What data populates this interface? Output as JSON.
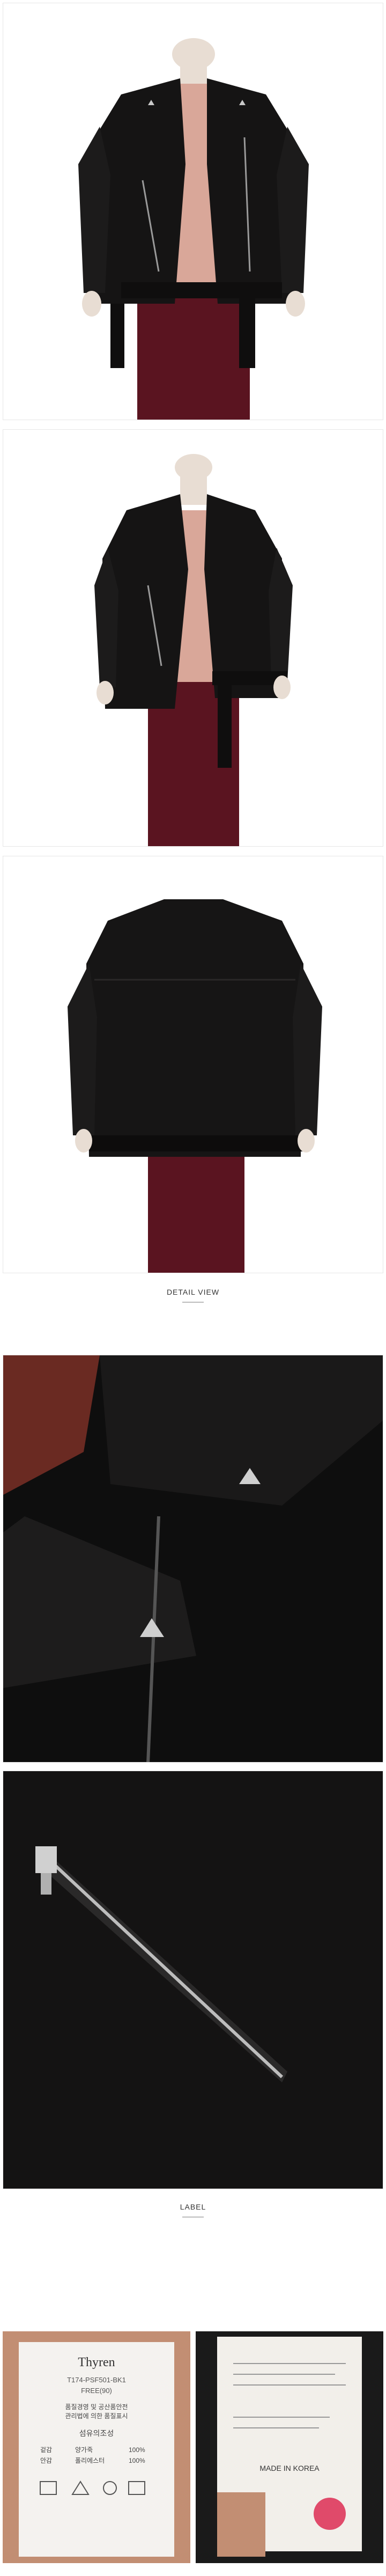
{
  "sections": {
    "detail_view": "DETAIL VIEW",
    "label": "LABEL"
  },
  "images": {
    "front_open": "jacket-front-open-photo",
    "front_styled": "jacket-front-styled-photo",
    "back": "jacket-back-photo",
    "collar_detail": "collar-stud-detail-photo",
    "zipper_detail": "zipper-pocket-detail-photo",
    "label_left": "care-label-photo",
    "label_right": "composition-label-photo"
  },
  "label_text": {
    "brand": "Thyren",
    "code1": "T174-PSF501-BK1",
    "code2": "FREE(90)",
    "notice1": "품질경영 및 공산품안전",
    "notice2": "관리법에 의한 품질표시",
    "composition_title": "섬유의조성",
    "outer_label": "겉감",
    "outer_material": "양가죽",
    "outer_pct": "100%",
    "lining_label": "안감",
    "lining_material": "폴리에스터",
    "lining_pct": "100%",
    "made_in": "MADE IN KOREA"
  },
  "colors": {
    "leather": "#151414",
    "trousers": "#5a1420",
    "skin": "#e9cfc2",
    "mannequin": "#e8ddd3"
  }
}
